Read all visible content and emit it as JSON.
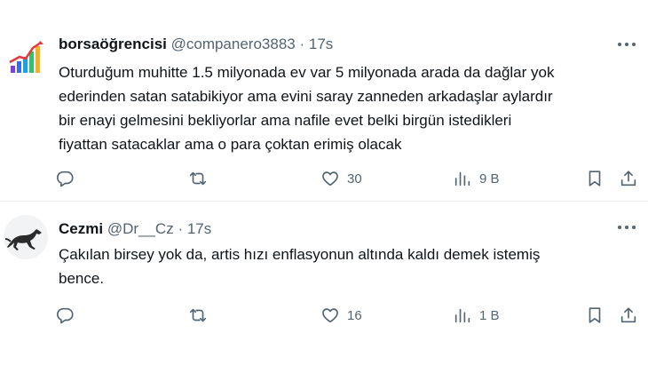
{
  "tweets": [
    {
      "display_name": "borsaöğrencisi",
      "handle": "@companero3883",
      "separator": "·",
      "time": "17s",
      "text_lines": [
        "Oturduğum muhitte 1.5 milyonada ev var 5 milyonada arada da dağlar yok",
        "ederinden satan satabikiyor ama evini saray zanneden arkadaşlar aylardır",
        "bir enayi gelmesini bekliyorlar ama nafile evet belki birgün istedikleri",
        "fiyattan satacaklar ama o para çoktan erimiş olacak"
      ],
      "replies": "",
      "retweets": "",
      "likes": "30",
      "views": "9 B",
      "avatar_icon": "rising-chart-avatar"
    },
    {
      "display_name": "Cezmi",
      "handle": "@Dr__Cz",
      "separator": "·",
      "time": "17s",
      "text_lines": [
        "Çakılan birsey yok da, artis hızı enflasyonun altında kaldı demek istemiş",
        "bence."
      ],
      "replies": "",
      "retweets": "",
      "likes": "16",
      "views": "1 B",
      "avatar_icon": "running-horse-avatar"
    }
  ],
  "colors": {
    "text": "#0f1419",
    "muted": "#536471",
    "divider": "#eff3f4"
  }
}
